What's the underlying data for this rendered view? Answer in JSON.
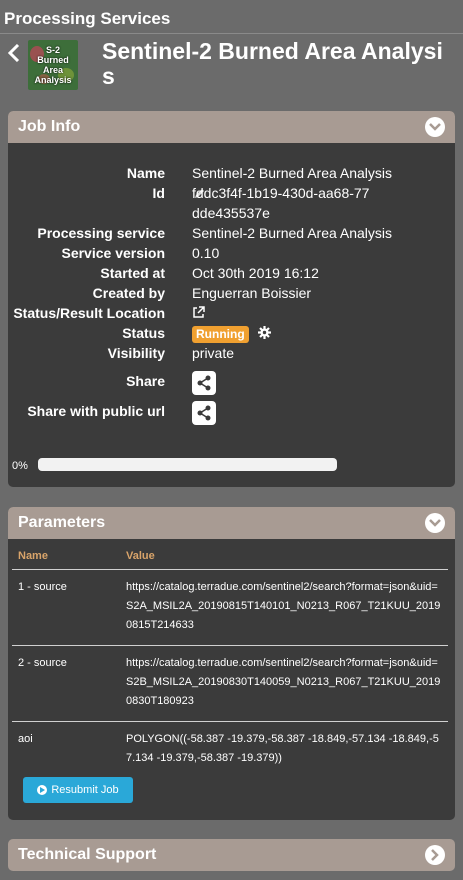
{
  "app_title": "Processing Services",
  "service": {
    "logo_text": "S-2\nBurned\nArea\nAnalysis",
    "logo_lines": [
      "S-2",
      "Burned",
      "Area",
      "Analysis"
    ],
    "title": "Sentinel-2 Burned Area Analysis"
  },
  "job_info": {
    "header": "Job Info",
    "rows": [
      {
        "label": "Name",
        "value": "Sentinel-2 Burned Area Analysis"
      },
      {
        "label": "Id",
        "value": "fddc3f4f-1b19-430d-aa68-77dde435537e"
      },
      {
        "label": "Processing service",
        "value": "Sentinel-2 Burned Area Analysis"
      },
      {
        "label": "Service version",
        "value": "0.10"
      },
      {
        "label": "Started at",
        "value": "Oct 30th 2019 16:12"
      },
      {
        "label": "Created by",
        "value": "Enguerran Boissier"
      },
      {
        "label": "Status/Result Location",
        "value": ""
      },
      {
        "label": "Status",
        "value": "Running"
      },
      {
        "label": "Visibility",
        "value": "private"
      }
    ],
    "share_label": "Share",
    "share_public_label": "Share with public url",
    "progress_label": "0%",
    "progress_value": 0
  },
  "parameters": {
    "header": "Parameters",
    "columns": [
      "Name",
      "Value"
    ],
    "rows": [
      {
        "name": "1 - source",
        "value": "https://catalog.terradue.com/sentinel2/search?format=json&uid=S2A_MSIL2A_20190815T140101_N0213_R067_T21KUU_20190815T214633"
      },
      {
        "name": "2 - source",
        "value": "https://catalog.terradue.com/sentinel2/search?format=json&uid=S2B_MSIL2A_20190830T140059_N0213_R067_T21KUU_20190830T180923"
      },
      {
        "name": "aoi",
        "value": "POLYGON((-58.387 -19.379,-58.387 -18.849,-57.134 -18.849,-57.134 -19.379,-58.387 -19.379))"
      }
    ],
    "resubmit_label": "Resubmit Job"
  },
  "technical_support": {
    "header": "Technical Support"
  },
  "colors": {
    "panel_header": "#a89b93",
    "panel_body": "#3b3b3b",
    "status_running": "#f0a030",
    "accent_button": "#2aa8d8",
    "table_header_text": "#d9a46a"
  },
  "icons": {
    "back": "chevron-left-icon",
    "collapse": "chevron-down-icon",
    "expand": "chevron-right-icon",
    "edit": "pencil-icon",
    "external_link": "external-link-icon",
    "settings": "gear-icon",
    "share": "share-icon",
    "play": "play-icon"
  }
}
